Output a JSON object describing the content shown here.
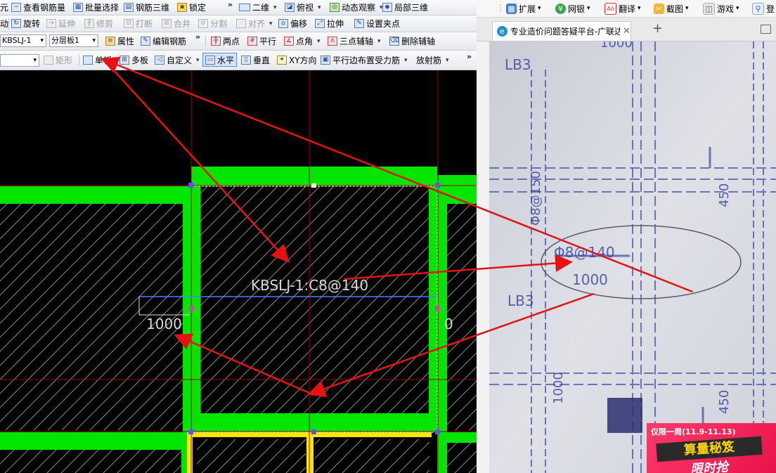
{
  "cad": {
    "toolbar1": {
      "item0": "元",
      "check_rebar": "查看钢筋量",
      "batch_select": "批量选择",
      "rebar_3d": "钢筋三维",
      "lock": "锁定",
      "view_mode": "二维",
      "top_view": "俯视",
      "dynamic_view": "动态观察",
      "partial_3d": "局部三维"
    },
    "toolbar2": {
      "item0": "动",
      "rotate": "旋转",
      "extend": "延伸",
      "trim": "修剪",
      "break": "打断",
      "merge": "合并",
      "split": "分割",
      "align": "对齐",
      "offset": "偏移",
      "stretch": "拉伸",
      "set_grip": "设置夹点"
    },
    "toolbar3": {
      "element_combo": "KBSLJ-1",
      "layer_combo": "分层板1",
      "properties": "属性",
      "edit_rebar": "编辑钢筋",
      "two_points": "两点",
      "parallel": "平行",
      "point_angle": "点角",
      "three_point_aux": "三点辅轴",
      "delete_aux": "删除辅轴"
    },
    "toolbar4": {
      "rect": "矩形",
      "single_slab": "单板",
      "multi_slab": "多板",
      "custom": "自定义",
      "horizontal": "水平",
      "vertical": "垂直",
      "xy_dir": "XY方向",
      "parallel_edge": "平行边布置受力筋",
      "radial": "放射筋"
    },
    "canvas": {
      "rebar_label": "KBSLJ-1:C8@140",
      "dim_left": "1000",
      "dim_right": "0"
    },
    "colors": {
      "beam": "#00e600",
      "wall": "#ffe600",
      "axis": "#a30000",
      "rebar_line": "#4f7fff",
      "arrow": "#e81010"
    }
  },
  "browser": {
    "toolbar": {
      "extend": "扩展",
      "online_bank": "网银",
      "translate": "翻译",
      "screenshot": "截图",
      "games": "游戏",
      "login": "登"
    },
    "tab_title": "专业造价问题答疑平台-广联达",
    "new_tab": "+",
    "photo": {
      "labels": [
        "LB3",
        "1000",
        "450",
        "Φ8@150",
        "Φ8@140",
        "1000",
        "LB3",
        "1000",
        "450"
      ]
    },
    "ad": {
      "top_text": "仅限一周(11.9-11.13)",
      "mid_text": "算量秘笈",
      "bottom_text": "限时抢"
    }
  }
}
